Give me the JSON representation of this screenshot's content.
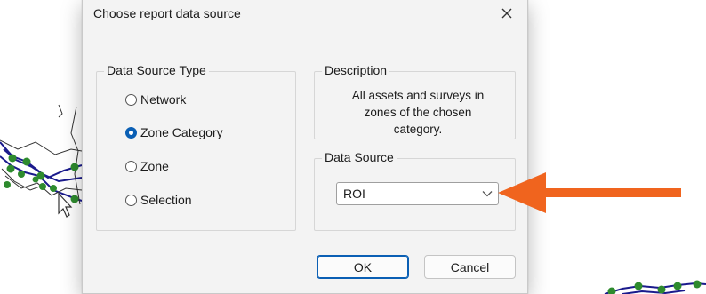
{
  "dialog": {
    "title": "Choose report data source",
    "close_icon": "close-icon"
  },
  "data_source_type": {
    "legend": "Data Source Type",
    "options": [
      {
        "label": "Network",
        "checked": false
      },
      {
        "label": "Zone Category",
        "checked": true
      },
      {
        "label": "Zone",
        "checked": false
      },
      {
        "label": "Selection",
        "checked": false
      }
    ]
  },
  "description": {
    "legend": "Description",
    "lines": [
      "All assets and surveys in",
      "zones of the chosen",
      "category."
    ]
  },
  "data_source": {
    "legend": "Data Source",
    "selected": "ROI",
    "dropdown_icon": "chevron-down-icon"
  },
  "buttons": {
    "ok": "OK",
    "cancel": "Cancel"
  },
  "colors": {
    "accent": "#0a5fb4",
    "annotation_arrow": "#f0641e",
    "map_node": "#2e8b2e",
    "map_line": "#1a1a8c"
  }
}
